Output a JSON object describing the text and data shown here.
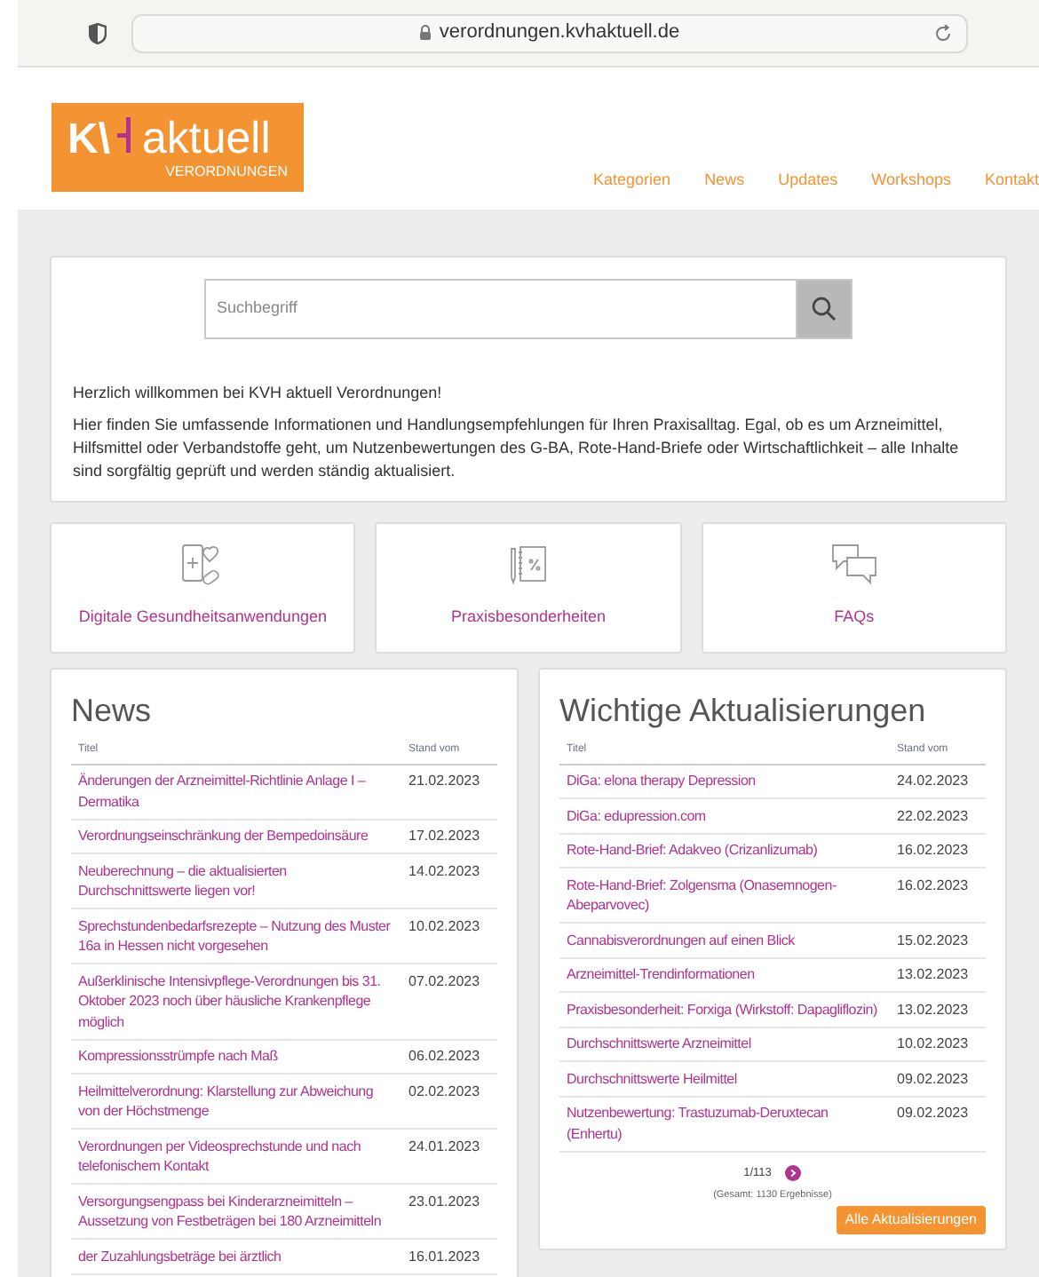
{
  "browser": {
    "url": "verordnungen.kvhaktuell.de"
  },
  "logo": {
    "mark": "K\\",
    "word": "aktuell",
    "sub": "VERORDNUNGEN"
  },
  "nav": [
    "Kategorien",
    "News",
    "Updates",
    "Workshops",
    "Kontakt"
  ],
  "search": {
    "placeholder": "Suchbegriff"
  },
  "intro": {
    "heading": "Herzlich willkommen bei KVH aktuell Verordnungen!",
    "text": "Hier finden Sie umfassende Informationen und Handlungsempfehlungen für Ihren Praxisalltag. Egal, ob es um Arzneimittel, Hilfsmittel oder Verbandstoffe geht, um Nutzenbewertungen des G-BA, Rote-Hand-Briefe oder Wirtschaftlichkeit – alle Inhalte sind sorgfältig geprüft und werden ständig aktualisiert."
  },
  "tiles": [
    {
      "kind": "phone",
      "label": "Digitale Gesundheitsanwendungen"
    },
    {
      "kind": "notebook",
      "label": "Praxisbesonderheiten"
    },
    {
      "kind": "chat",
      "label": "FAQs"
    }
  ],
  "news": {
    "title": "News",
    "columns": [
      "Titel",
      "Stand vom"
    ],
    "rows": [
      {
        "title": "Änderungen der Arzneimittel-Richtlinie Anlage I – Dermatika",
        "date": "21.02.2023"
      },
      {
        "title": "Verordnungseinschränkung der Bempedoinsäure",
        "date": "17.02.2023"
      },
      {
        "title": "Neuberechnung – die aktualisierten Durchschnittswerte liegen vor!",
        "date": "14.02.2023"
      },
      {
        "title": "Sprechstundenbedarfsrezepte – Nutzung des Muster 16a in Hessen nicht vorgesehen",
        "date": "10.02.2023"
      },
      {
        "title": "Außerklinische Intensivpflege-Verordnungen bis 31. Oktober 2023 noch über häusliche Krankenpflege möglich",
        "date": "07.02.2023"
      },
      {
        "title": "Kompressionsstrümpfe nach Maß",
        "date": "06.02.2023"
      },
      {
        "title": "Heilmittelverordnung: Klarstellung zur Abweichung von der Höchstmenge",
        "date": "02.02.2023"
      },
      {
        "title": "Verordnungen per Videosprechstunde und nach telefonischem Kontakt",
        "date": "24.01.2023"
      },
      {
        "title": "Versorgungsengpass bei Kinderarzneimitteln – Aussetzung von Festbeträgen bei 180 Arzneimitteln",
        "date": "23.01.2023"
      },
      {
        "title": "der Zuzahlungsbeträge bei ärztlich",
        "date": "16.01.2023"
      }
    ]
  },
  "updates": {
    "title": "Wichtige Aktualisierungen",
    "columns": [
      "Titel",
      "Stand vom"
    ],
    "rows": [
      {
        "title": "DiGa: elona therapy Depression",
        "date": "24.02.2023"
      },
      {
        "title": "DiGa: edupression.com",
        "date": "22.02.2023"
      },
      {
        "title": "Rote-Hand-Brief: Adakveo (Crizanlizumab)",
        "date": "16.02.2023"
      },
      {
        "title": "Rote-Hand-Brief: Zolgensma (Onasemnogen-Abeparvovec)",
        "date": "16.02.2023"
      },
      {
        "title": "Cannabisverordnungen auf einen Blick",
        "date": "15.02.2023"
      },
      {
        "title": "Arzneimittel-Trendinformationen",
        "date": "13.02.2023"
      },
      {
        "title": "Praxisbesonderheit: Forxiga (Wirkstoff: Dapagliflozin)",
        "date": "13.02.2023"
      },
      {
        "title": "Durchschnittswerte Arzneimittel",
        "date": "10.02.2023"
      },
      {
        "title": "Durchschnittswerte Heilmittel",
        "date": "09.02.2023"
      },
      {
        "title": "Nutzenbewertung: Trastuzumab-Deruxtecan (Enhertu)",
        "date": "09.02.2023"
      }
    ],
    "pager": "1/113",
    "total": "(Gesamt: 1130 Ergebnisse)",
    "button": "Alle Aktualisierungen"
  }
}
